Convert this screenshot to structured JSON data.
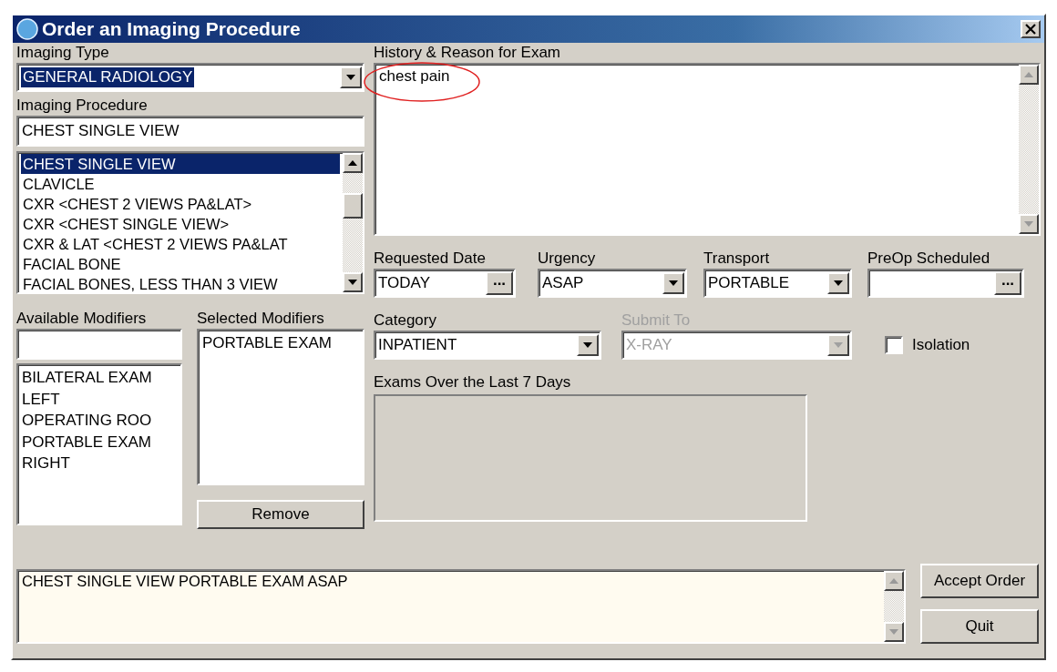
{
  "window": {
    "title": "Order an Imaging Procedure"
  },
  "imaging_type": {
    "label": "Imaging Type",
    "value": "GENERAL RADIOLOGY",
    "highlighted": true
  },
  "imaging_procedure": {
    "label": "Imaging Procedure",
    "value": "CHEST SINGLE VIEW"
  },
  "procedure_list": [
    {
      "text": "CHEST SINGLE VIEW",
      "selected": true
    },
    {
      "text": "CLAVICLE",
      "selected": false
    },
    {
      "text": "CXR <CHEST 2 VIEWS PA&LAT>",
      "selected": false
    },
    {
      "text": "CXR <CHEST SINGLE VIEW>",
      "selected": false
    },
    {
      "text": "CXR & LAT <CHEST 2 VIEWS PA&LAT",
      "selected": false
    },
    {
      "text": "FACIAL BONE",
      "selected": false
    },
    {
      "text": "FACIAL BONES, LESS THAN 3 VIEW",
      "selected": false
    }
  ],
  "available_modifiers": {
    "label": "Available Modifiers",
    "items": [
      "BILATERAL EXAM",
      "LEFT",
      "OPERATING ROO",
      "PORTABLE EXAM",
      "RIGHT"
    ]
  },
  "selected_modifiers": {
    "label": "Selected Modifiers",
    "items": [
      "PORTABLE EXAM"
    ]
  },
  "remove_button": "Remove",
  "history": {
    "label": "History & Reason for Exam",
    "value": "chest pain"
  },
  "fields_row_1": [
    {
      "kind": "date",
      "label": "Requested Date",
      "value": "TODAY",
      "button": "...",
      "disabled": false
    },
    {
      "kind": "combo",
      "label": "Urgency",
      "value": "ASAP",
      "disabled": false
    },
    {
      "kind": "combo",
      "label": "Transport",
      "value": "PORTABLE",
      "disabled": false
    },
    {
      "kind": "date",
      "label": "PreOp Scheduled",
      "button": "...",
      "disabled": false
    }
  ],
  "fields_row_2": [
    {
      "kind": "combo",
      "label": "Category",
      "value": "INPATIENT",
      "disabled": false
    },
    {
      "kind": "combo",
      "label": "Submit To",
      "value": "X-RAY",
      "disabled": true
    }
  ],
  "isolation": {
    "label": "Isolation",
    "checked": false
  },
  "exams": {
    "label": "Exams Over the Last 7 Days"
  },
  "order_summary": {
    "value": "CHEST SINGLE VIEW PORTABLE EXAM ASAP"
  },
  "buttons": [
    "Accept Order",
    "Quit"
  ]
}
